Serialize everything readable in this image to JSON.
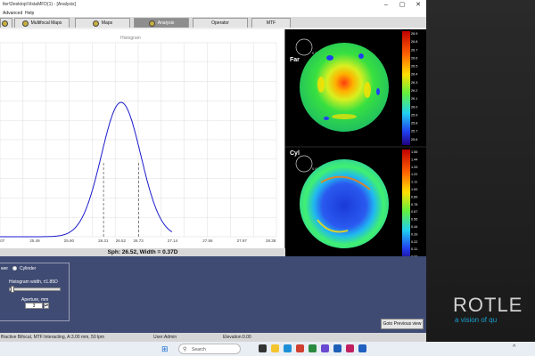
{
  "window": {
    "title": "tler\\Desktop\\VistaMFD(1) - [Analysis]"
  },
  "menu": [
    "Advanced",
    "Help"
  ],
  "tabs": [
    {
      "label": "",
      "icon": "map-icon"
    },
    {
      "label": "Multifocal Maps",
      "icon": "map-icon"
    },
    {
      "label": "Maps",
      "icon": "map-icon"
    },
    {
      "label": "Analysis",
      "icon": "map-icon"
    },
    {
      "label": "Operator"
    },
    {
      "label": "MTF"
    }
  ],
  "histogram": {
    "title": "Histogram",
    "x_ticks": [
      "25.07",
      "25.49",
      "25.90",
      "26.31",
      "26.52",
      "26.73",
      "27.14",
      "27.56",
      "27.97",
      "28.38"
    ],
    "readout": "Sph: 26.52,   Width = 0.37D"
  },
  "chart_data": {
    "type": "line",
    "title": "Histogram",
    "x_ticks": [
      25.07,
      25.49,
      25.9,
      26.31,
      26.52,
      26.73,
      27.14,
      27.56,
      27.97,
      28.38
    ],
    "peak_x": 26.52,
    "width": 0.37,
    "dashed_markers": [
      26.31,
      26.73
    ]
  },
  "maps": {
    "far": {
      "label": "Far",
      "aperture": "0.67"
    },
    "cyl": {
      "label": "Cyl",
      "aperture": "0.65"
    },
    "far_scale": [
      "26.9",
      "26.8",
      "26.7",
      "26.6",
      "26.5",
      "26.4",
      "26.3",
      "26.2",
      "26.1",
      "26.0",
      "25.9",
      "25.8",
      "25.7",
      "25.6"
    ],
    "cyl_scale": [
      "1.55",
      "1.44",
      "1.33",
      "1.22",
      "1.11",
      "1.00",
      "0.89",
      "0.78",
      "0.67",
      "0.56",
      "0.44",
      "0.33",
      "0.22",
      "0.11",
      "0.00"
    ]
  },
  "bottom_panel": {
    "radio_left": "wer",
    "radio_cyl": "Cylinder",
    "slider_label": "Histogram width, ±1.85D",
    "aperture_label": "Aperture, mm",
    "aperture_value": "3",
    "goto_label": "Goto Previous view"
  },
  "status": {
    "left": "ffractive Bifocal, MTF:Interacting, A:3.00 mm, 50 lpm",
    "user": "User:Admin",
    "elevation": "Elevation:0.00"
  },
  "desktop": {
    "brand": "ROTLE",
    "tagline": "a vision of qu"
  },
  "taskbar": {
    "search_placeholder": "Search"
  },
  "colors": {
    "bottom_panel": "#3f4b73",
    "curve": "#1a1acc",
    "brand_accent": "#2ab0d8"
  }
}
